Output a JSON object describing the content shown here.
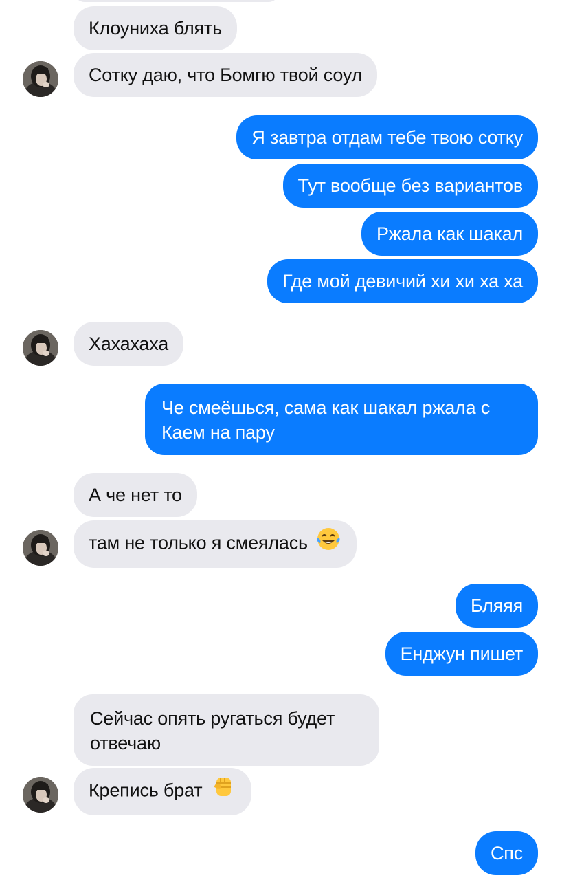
{
  "chat": {
    "messages": [
      {
        "side": "in",
        "text": "Клоуниха блять"
      },
      {
        "side": "in",
        "text": "Сотку даю, что Бомгю твой соул"
      },
      {
        "side": "out",
        "text": "Я завтра отдам тебе твою сотку"
      },
      {
        "side": "out",
        "text": "Тут вообще без вариантов"
      },
      {
        "side": "out",
        "text": "Ржала как шакал"
      },
      {
        "side": "out",
        "text": "Где мой девичий хи хи ха ха"
      },
      {
        "side": "in",
        "text": "Хахахаха"
      },
      {
        "side": "out",
        "text": "Че смеёшься, сама как шакал ржала с Каем на пару"
      },
      {
        "side": "in",
        "text": "А че нет то"
      },
      {
        "side": "in",
        "text": "там не только я смеялась",
        "emoji": "tears-of-joy-emoji"
      },
      {
        "side": "out",
        "text": "Бляяя"
      },
      {
        "side": "out",
        "text": "Енджун пишет"
      },
      {
        "side": "in",
        "text": "Сейчас опять ругаться будет отвечаю"
      },
      {
        "side": "in",
        "text": "Крепись брат",
        "emoji": "raised-fist-emoji"
      },
      {
        "side": "out",
        "text": "Спс"
      }
    ]
  },
  "colors": {
    "incoming_bubble": "#e9e9ee",
    "outgoing_bubble": "#0a7cff",
    "incoming_text": "#111111",
    "outgoing_text": "#ffffff"
  },
  "icons": {
    "avatar": "contact-avatar"
  }
}
